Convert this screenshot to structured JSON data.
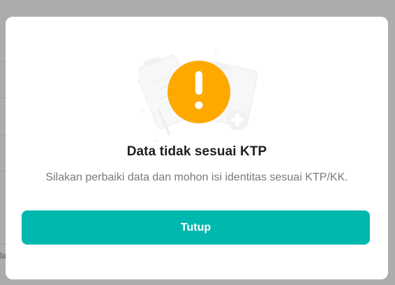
{
  "background": {
    "overlay_color": "#acacac",
    "fragment_text": "la"
  },
  "dialog": {
    "icon": "warning-exclamation-icon",
    "accent_color": "#ffa800",
    "title": "Data tidak sesuai KTP",
    "message": "Silakan perbaiki data dan mohon isi identitas sesuai KTP/KK.",
    "button_label": "Tutup",
    "button_color": "#00b8ad"
  }
}
